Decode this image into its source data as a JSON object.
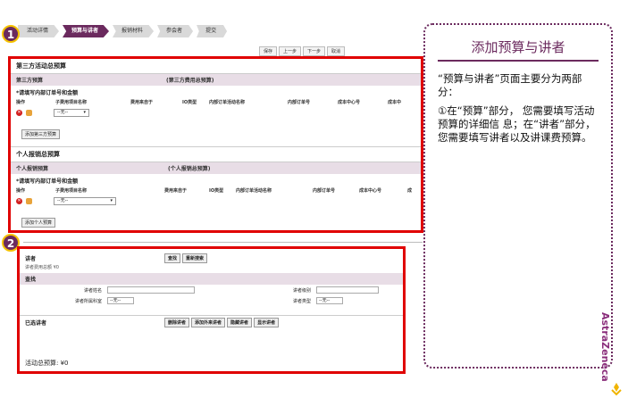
{
  "steps": [
    {
      "label": "活动详情",
      "active": false
    },
    {
      "label": "预算与讲者",
      "active": true
    },
    {
      "label": "报销材料",
      "active": false
    },
    {
      "label": "参会者",
      "active": false
    },
    {
      "label": "提交",
      "active": false
    }
  ],
  "pager": [
    "保存",
    "上一步",
    "下一步",
    "取消"
  ],
  "markers": {
    "one": "1",
    "two": "2"
  },
  "panel1": {
    "title": "第三方活动总预算",
    "third_party": {
      "band_left": "第三方预算",
      "band_mid": "(第三方费用总预算)",
      "sub": "*请填写内部订单号和金额",
      "headers": [
        "操作",
        "子费用项目名称",
        "费用来自于",
        "IO类型",
        "内部订单活动名称",
        "内部订单号",
        "成本中心号",
        "成本中"
      ],
      "select_value": "--无--",
      "add_button": "添加第三方预算"
    },
    "personal_title": "个人报销总预算",
    "personal": {
      "band_left": "个人报销预算",
      "band_mid": "(个人报销总预算)",
      "sub": "*请填写内部订单号和金额",
      "headers": [
        "操作",
        "子费用项目名称",
        "费用来自于",
        "IO类型",
        "内部订单活动名称",
        "内部订单号",
        "成本中心号",
        "成"
      ],
      "select_value": "--无--",
      "add_button": "添加个人预算"
    }
  },
  "panel2": {
    "heading": "讲者",
    "head_buttons": [
      "查找",
      "重新搜索"
    ],
    "total_fee": "讲者费用总额 ¥0",
    "search_band": "查找",
    "fields": {
      "name_label": "讲者姓名",
      "level_label": "讲者级别",
      "category_label": "讲者所属科室",
      "category_value": "--无--",
      "type_label": "讲者类型",
      "type_value": "--无--"
    },
    "selected_heading": "已选讲者",
    "selected_buttons": [
      "删除讲者",
      "添加外来讲者",
      "隐藏讲者",
      "显示讲者"
    ],
    "total_budget": "活动总预算: ¥0"
  },
  "note": {
    "title": "添加预算与讲者",
    "p1": "“预算与讲者”页面主要分为两部分：",
    "p2": "①在“预算”部分， 您需要填写活动预算的详细信 息；在“讲者”部分，您需要填写讲者以及讲课费预算。"
  },
  "brand": "AstraZeneca",
  "colors": {
    "accent": "#6b2a5e",
    "highlight": "#e00000"
  }
}
